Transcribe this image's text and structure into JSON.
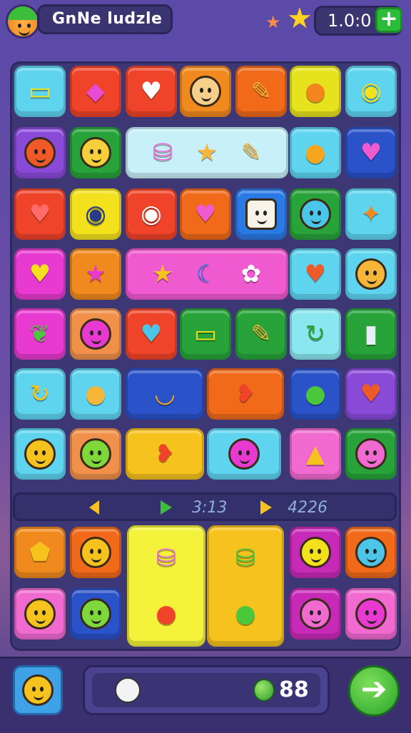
{
  "header": {
    "game_title": "GnNe ludzle",
    "coin_amount": "1.0:0",
    "plus_label": "+"
  },
  "status_bar": {
    "value_left": "3:13",
    "value_right": "4226"
  },
  "bottom_bar": {
    "score_value": "88"
  },
  "colors": {
    "board_bg": "#3e3775",
    "accent_green": "#2bbd3a"
  }
}
